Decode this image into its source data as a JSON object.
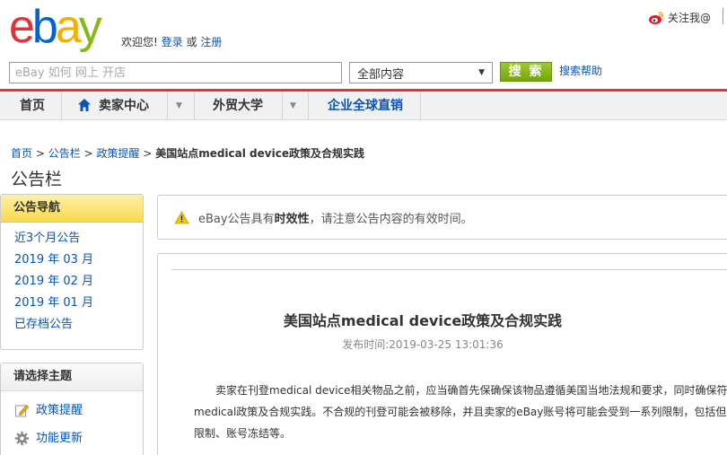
{
  "header": {
    "logo_letters": [
      "e",
      "b",
      "a",
      "y"
    ],
    "welcome_text": "欢迎您!",
    "login_link": "登录",
    "or_text": "或",
    "register_link": "注册",
    "follow_text": "关注我@"
  },
  "search": {
    "placeholder": "eBay 如何 网上 开店",
    "category_selected": "全部内容",
    "button_label": "搜 索",
    "help_link": "搜索帮助"
  },
  "nav": {
    "items": [
      {
        "label": "首页"
      },
      {
        "label": "卖家中心"
      },
      {
        "label": "外贸大学"
      },
      {
        "label": "企业全球直销"
      }
    ]
  },
  "breadcrumb": {
    "items": [
      "首页",
      "公告栏",
      "政策提醒"
    ],
    "separator": ">",
    "current": "美国站点medical device政策及合规实践"
  },
  "page_title": "公告栏",
  "sidebar": {
    "nav_box": {
      "title": "公告导航",
      "items": [
        "近3个月公告",
        "2019 年 03 月",
        "2019 年 02 月",
        "2019 年 01 月",
        "已存档公告"
      ]
    },
    "topic_box": {
      "title": "请选择主题",
      "items": [
        {
          "label": "政策提醒",
          "icon": "edit-icon"
        },
        {
          "label": "功能更新",
          "icon": "gear-icon"
        }
      ]
    }
  },
  "notice": {
    "prefix": "eBay公告具有",
    "bold": "时效性",
    "suffix": "，请注意公告内容的有效时间。"
  },
  "article": {
    "title": "美国站点medical device政策及合规实践",
    "date": "发布时间:2019-03-25 13:01:36",
    "lines": [
      "卖家在刊登medical device相关物品之前，应当确首先保确保该物品遵循美国当地法规和要求，同时确保符合",
      "medical政策及合规实践。不合规的刊登可能会被移除，并且卖家的eBay账号将可能会受到一系列限制，包括但不",
      "限制、账号冻结等。"
    ]
  },
  "colors": {
    "brand_red": "#e53238",
    "brand_blue": "#0064d2",
    "brand_yellow": "#f5af02",
    "brand_green": "#86b817",
    "link_blue": "#0654ba"
  }
}
